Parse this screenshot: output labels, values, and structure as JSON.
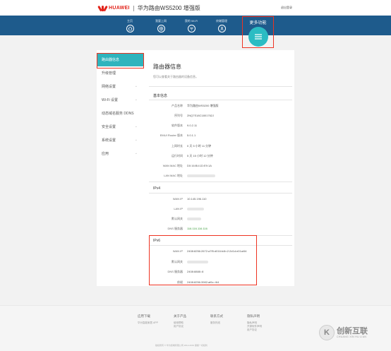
{
  "header": {
    "brand": "HUAWEI",
    "model": "华为路由WS5200 增强版",
    "language": "退出登录"
  },
  "nav": {
    "items": [
      {
        "label": "主页",
        "icon": "home-icon"
      },
      {
        "label": "我要上网",
        "icon": "globe-icon"
      },
      {
        "label": "我的 Wi-Fi",
        "icon": "wifi-icon"
      },
      {
        "label": "终端管理",
        "icon": "device-icon"
      }
    ],
    "more": {
      "label": "更多功能",
      "icon": "menu-icon"
    }
  },
  "sidebar": {
    "items": [
      {
        "label": "路由器信息",
        "active": true
      },
      {
        "label": "升级管理"
      },
      {
        "label": "网络设置"
      },
      {
        "label": "Wi-Fi 设置"
      },
      {
        "label": "动态域名服务 DDNS"
      },
      {
        "label": "安全设置"
      },
      {
        "label": "系统设置"
      },
      {
        "label": "应用"
      }
    ]
  },
  "main": {
    "title": "路由器信息",
    "description": "您可以查看关于路由器的设备信息。",
    "basic": {
      "title": "基本信息",
      "rows": [
        {
          "label": "产品名称",
          "value": "华为路由WS5200 增强版"
        },
        {
          "label": "序列号",
          "value": "2NQ7S18C1801762J"
        },
        {
          "label": "软件版本",
          "value": "9.0.2.11"
        },
        {
          "label": "EMUI Router 版本",
          "value": "5.0.1.1"
        },
        {
          "label": "上网时长",
          "value": "0 天 5 小时 11 分钟"
        },
        {
          "label": "运行时间",
          "value": "5 天 15 小时 12 分钟"
        },
        {
          "label": "WAN MAC 地址",
          "value": "D0:16:B4:1D:E9:1A"
        },
        {
          "label": "LAN MAC 地址",
          "value": ""
        }
      ]
    },
    "ipv4": {
      "title": "IPv4",
      "rows": [
        {
          "label": "WAN IP",
          "value": "10.145.196.110"
        },
        {
          "label": "LAN IP",
          "value": ""
        },
        {
          "label": "默认网关",
          "value": ""
        },
        {
          "label": "DNS 服务器",
          "value": "116.116.116.116"
        }
      ]
    },
    "ipv6": {
      "title": "IPv6",
      "rows": [
        {
          "label": "WAN IP",
          "value": "2408:8256:2672:a7f5:d016:b4b:2:2d1d:e01a/64"
        },
        {
          "label": "默认网关",
          "value": ""
        },
        {
          "label": "DNS 服务器",
          "value": "2408:8888::8"
        },
        {
          "label": "前缀",
          "value": "2408:8256:3982:af6c::/64"
        }
      ]
    }
  },
  "footer": {
    "columns": [
      {
        "heading": "应用下载",
        "links": [
          "华为智能家居 APP"
        ]
      },
      {
        "heading": "关于产品",
        "links": [
          "使用帮助",
          "用户协议"
        ]
      },
      {
        "heading": "联系方式",
        "links": [
          "服务热线"
        ]
      },
      {
        "heading": "隐私声明",
        "links": [
          "隐私声明",
          "开源软件声明",
          "用户协议"
        ]
      }
    ],
    "copyright": "版权所有 © 华为终端有限公司 2012-2019 保留一切权利"
  },
  "watermark": {
    "glyph": "K",
    "text": "创新互联",
    "sub": "CHUANG XIN HU LIAN"
  },
  "colors": {
    "brand": "#e2231a",
    "navbar": "#1e5b8c",
    "accent": "#2fb4bd",
    "highlight_box": "#ee3322"
  }
}
